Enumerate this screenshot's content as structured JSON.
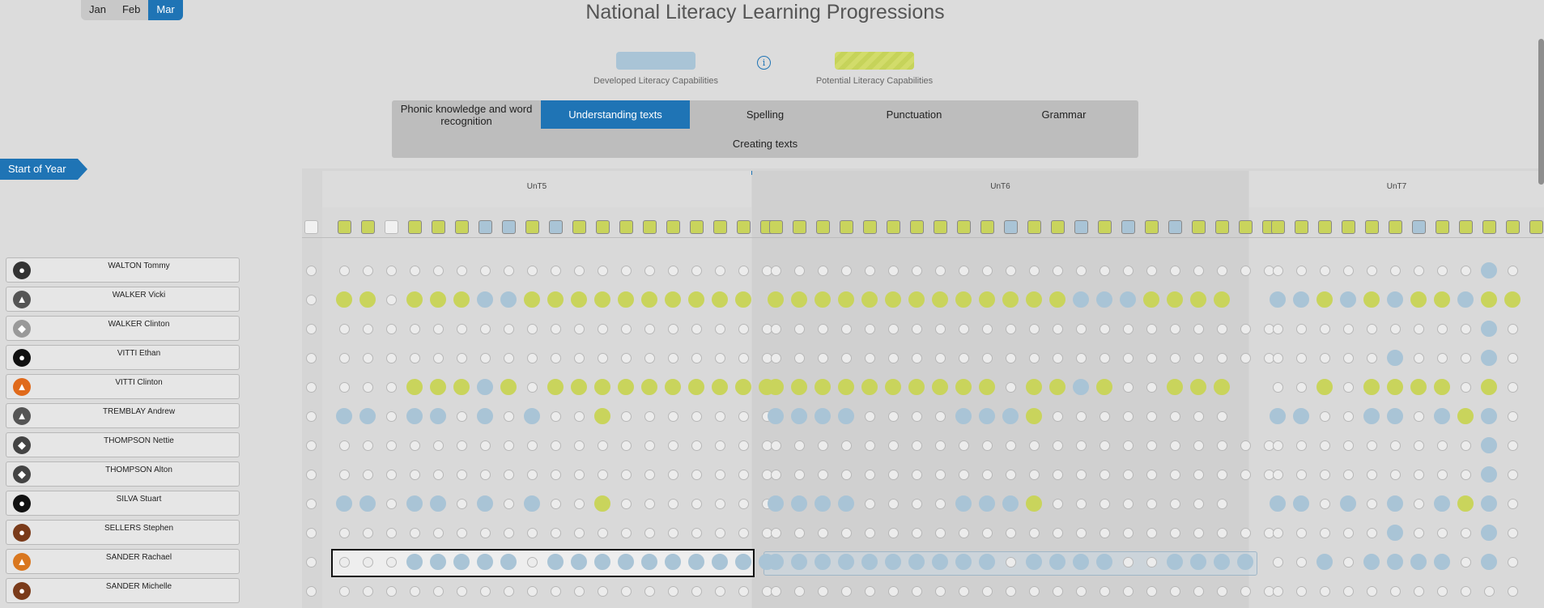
{
  "months": {
    "items": [
      "Jan",
      "Feb",
      "Mar"
    ],
    "active": "Mar"
  },
  "title": "National Literacy Learning Progressions",
  "legend": {
    "developed": "Developed Literacy Capabilities",
    "potential": "Potential Literacy Capabilities"
  },
  "tabs": [
    {
      "label": "Phonic knowledge and word recognition",
      "active": false
    },
    {
      "label": "Understanding texts",
      "active": true
    },
    {
      "label": "Spelling",
      "active": false
    },
    {
      "label": "Punctuation",
      "active": false
    },
    {
      "label": "Grammar",
      "active": false
    },
    {
      "label": "Creating texts",
      "active": false
    }
  ],
  "start_of_year": "Start of Year",
  "groups": [
    "UnT5",
    "UnT6",
    "UnT7"
  ],
  "column_status": {
    "lead": "e",
    "UnT5": "ggegggbbgbggggggggg",
    "UnT6": "ggggggggggbggbgbgbgggg",
    "UnT7": "ggggggbgggggg"
  },
  "students": [
    {
      "name": "WALTON Tommy",
      "avatar": "panda",
      "lead": "e",
      "UnT5": "eeeeeeeeeeeeeeeeeee",
      "UnT6": "eeeeeeeeeeeeeeeeeeeeee",
      "UnT7": "eeeeeeeeebe"
    },
    {
      "name": "WALKER Vicki",
      "avatar": "wolf",
      "lead": "e",
      "UnT5": "ggegggbbgggggggggg",
      "UnT6": "gggggggggggggbbbgggg",
      "UnT7": "bbgbgbggbgg"
    },
    {
      "name": "WALKER Clinton",
      "avatar": "rabbit",
      "lead": "e",
      "UnT5": "eeeeeeeeeeeeeeeeeee",
      "UnT6": "eeeeeeeeeeeeeeeeeeeeee",
      "UnT7": "eeeeeeeeebe"
    },
    {
      "name": "VITTI Ethan",
      "avatar": "penguin",
      "lead": "e",
      "UnT5": "eeeeeeeeeeeeeeeeeee",
      "UnT6": "eeeeeeeeeeeeeeeeeeeeee",
      "UnT7": "eeeeebeeebe"
    },
    {
      "name": "VITTI Clinton",
      "avatar": "fox",
      "lead": "e",
      "UnT5": "eeegggbgegggggggggg",
      "UnT6": "ggggggggggeggbgeeggg",
      "UnT7": "eegeggggege"
    },
    {
      "name": "TREMBLAY Andrew",
      "avatar": "wolf",
      "lead": "e",
      "UnT5": "bbebbebebeegeeeeeee",
      "UnT6": "bbbbeeeebbbgeeeeeeee",
      "UnT7": "bbeebbebgbe"
    },
    {
      "name": "THOMPSON Nettie",
      "avatar": "cat",
      "lead": "e",
      "UnT5": "eeeeeeeeeeeeeeeeeee",
      "UnT6": "eeeeeeeeeeeeeeeeeeeeee",
      "UnT7": "eeeeeeeeebe"
    },
    {
      "name": "THOMPSON Alton",
      "avatar": "cat",
      "lead": "e",
      "UnT5": "eeeeeeeeeeeeeeeeeee",
      "UnT6": "eeeeeeeeeeeeeeeeeeeeee",
      "UnT7": "eeeeeeeeebe"
    },
    {
      "name": "SILVA Stuart",
      "avatar": "penguin",
      "lead": "e",
      "UnT5": "bbebbebebeegeeeeeee",
      "UnT6": "bbbbeeeebbbgeeeeeeee",
      "UnT7": "bbebebebgbe"
    },
    {
      "name": "SELLERS Stephen",
      "avatar": "monkey",
      "lead": "e",
      "UnT5": "eeeeeeeeeeeeeeeeeee",
      "UnT6": "eeeeeeeeeeeeeeeeeeeeee",
      "UnT7": "eeeeebeeebe"
    },
    {
      "name": "SANDER Rachael",
      "avatar": "tiger",
      "lead": "e",
      "UnT5": "eeebbbbbebbbbbbbbbb",
      "UnT6": "bbbbbbbbbbebbbbeebbbb",
      "UnT7": "eebebbbbebe"
    },
    {
      "name": "SANDER Michelle",
      "avatar": "monkey",
      "lead": "e",
      "UnT5": "eeeeeeeeeeeeeeeeeee",
      "UnT6": "eeeeeeeeeeeeeeeeeeeeee",
      "UnT7": "eeeeeeeeeee"
    }
  ],
  "colors": {
    "accent": "#1f74b5",
    "developed": "#a9c4d6",
    "potential": "#c9d45c"
  }
}
